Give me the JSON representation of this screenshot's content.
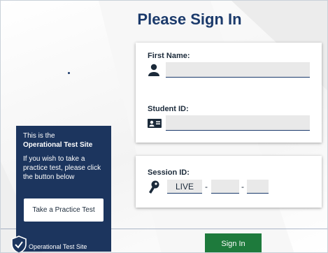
{
  "page": {
    "title": "Please Sign In"
  },
  "form": {
    "first_name_label": "First Name:",
    "first_name_value": "",
    "student_id_label": "Student ID:",
    "student_id_value": "",
    "session_id_label": "Session ID:",
    "session_prefix": "LIVE",
    "session_separator": "-",
    "session_part1_value": "",
    "session_part2_value": ""
  },
  "notice": {
    "line1": "This is the",
    "line2": "Operational Test Site",
    "body": "If you wish to take a practice test, please click the button below",
    "practice_button_label": "Take a Practice Test",
    "site_label": "Operational Test Site"
  },
  "actions": {
    "signin_label": "Sign In"
  },
  "colors": {
    "title": "#1b3a6b",
    "notice_bg": "#1c355e",
    "signin_bg": "#1e7a3c"
  },
  "icons": {
    "first_name": "person-icon",
    "student_id": "id-card-icon",
    "session_id": "key-icon",
    "site": "shield-check-icon"
  }
}
